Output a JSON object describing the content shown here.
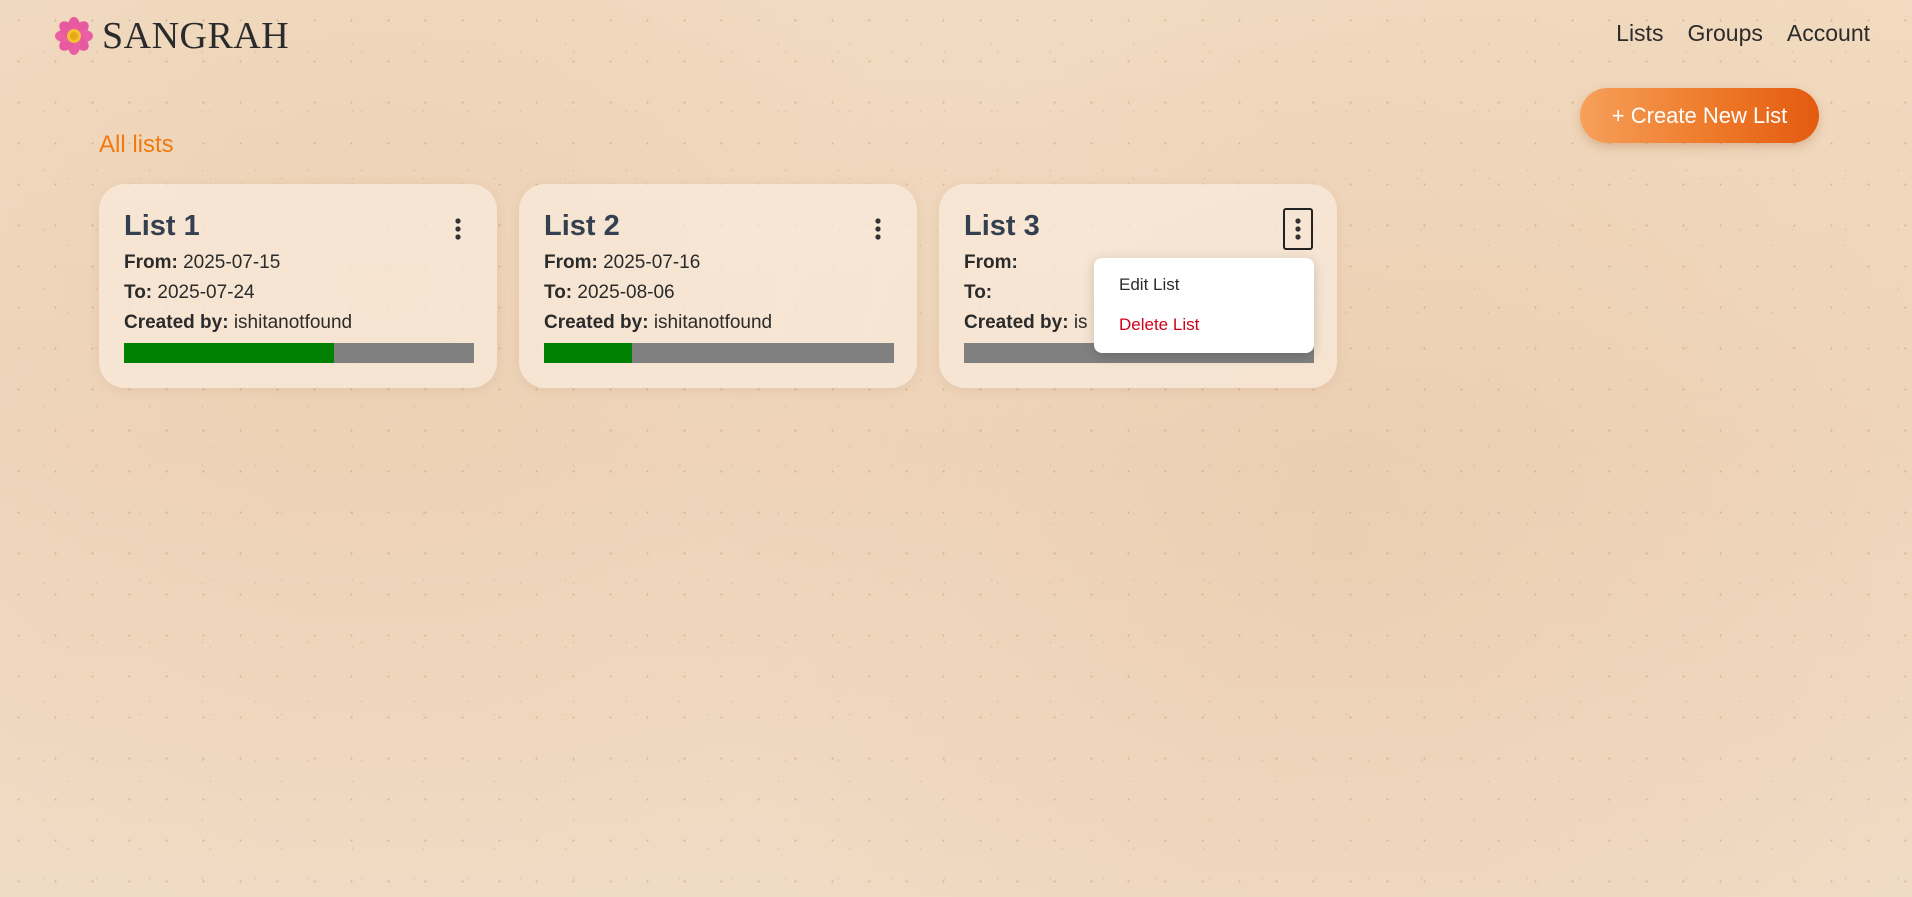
{
  "app": {
    "name": "SANGRAH",
    "logo_icon": "flower-icon"
  },
  "nav": {
    "lists": "Lists",
    "groups": "Groups",
    "account": "Account"
  },
  "actions": {
    "create_label": "+ Create New List"
  },
  "section": {
    "title": "All lists"
  },
  "labels": {
    "from": "From:",
    "to": "To:",
    "created_by": "Created by:"
  },
  "lists": [
    {
      "title": "List 1",
      "from": "2025-07-15",
      "to": "2025-07-24",
      "created_by": "ishitanotfound",
      "progress": 0.6
    },
    {
      "title": "List 2",
      "from": "2025-07-16",
      "to": "2025-08-06",
      "created_by": "ishitanotfound",
      "progress": 0.25
    },
    {
      "title": "List 3",
      "from": "",
      "to": "",
      "created_by": "is",
      "progress": 0.0
    }
  ],
  "menu": {
    "edit": "Edit List",
    "delete": "Delete List"
  },
  "colors": {
    "accent": "#f07a10",
    "progress_done": "#008000",
    "progress_remaining": "#808080",
    "danger": "#d0021b",
    "card_title": "#34404f"
  }
}
